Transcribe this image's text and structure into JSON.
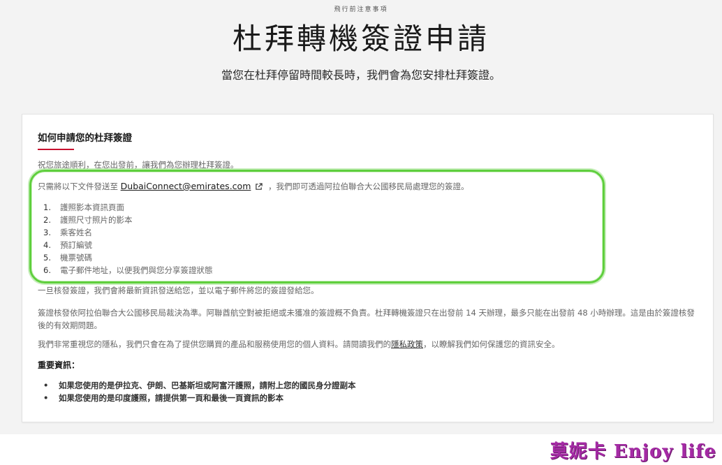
{
  "header": {
    "eyebrow": "飛行前注意事項",
    "title": "杜拜轉機簽證申請",
    "subtitle": "當您在杜拜停留時間較長時，我們會為您安排杜拜簽證。"
  },
  "card": {
    "title": "如何申請您的杜拜簽證",
    "intro": "祝您旅途順利，在您出發前，讓我們為您辦理杜拜簽證。",
    "send_prefix": "只需將以下文件發送至",
    "email": "DubaiConnect@emirates.com",
    "send_suffix": "，我們即可透過阿拉伯聯合大公國移民局處理您的簽證。",
    "documents": [
      {
        "num": "1.",
        "text": "護照影本資訊頁面"
      },
      {
        "num": "2.",
        "text": "護照尺寸照片的影本"
      },
      {
        "num": "3.",
        "text": "乘客姓名"
      },
      {
        "num": "4.",
        "text": "預訂編號"
      },
      {
        "num": "5.",
        "text": "機票號碼"
      },
      {
        "num": "6.",
        "text": "電子郵件地址，以便我們與您分享簽證狀態"
      }
    ],
    "once_approved": "一旦核發簽證，我們會將最新資訊發送給您，並以電子郵件將您的簽證發給您。",
    "decision": "簽證核發依阿拉伯聯合大公國移民局裁決為準。阿聯酋航空對被拒絕或未獲准的簽證概不負責。杜拜轉機簽證只在出發前 14 天辦理，最多只能在出發前 48 小時辦理。這是由於簽證核發後的有效期問題。",
    "privacy_prefix": "我們非常重視您的隱私，我們只會在為了提供您購買的產品和服務使用您的個人資料。請閱讀我們的",
    "privacy_link": "隱私政策",
    "privacy_suffix": "，以瞭解我們如何保護您的資訊安全。",
    "important_title": "重要資訊：",
    "important": [
      "如果您使用的是伊拉克、伊朗、巴基斯坦或阿富汗護照，請附上您的國民身分證副本",
      "如果您使用的是印度護照，請提供第一頁和最後一頁資訊的影本"
    ]
  },
  "watermark": "莫妮卡 Enjoy life",
  "colors": {
    "accent": "#c8102e",
    "highlight": "#5fcf3d",
    "watermark": "#a52aa5",
    "page_bg": "#f3f3f3"
  },
  "icons": {
    "email_link": "external-link-icon"
  }
}
